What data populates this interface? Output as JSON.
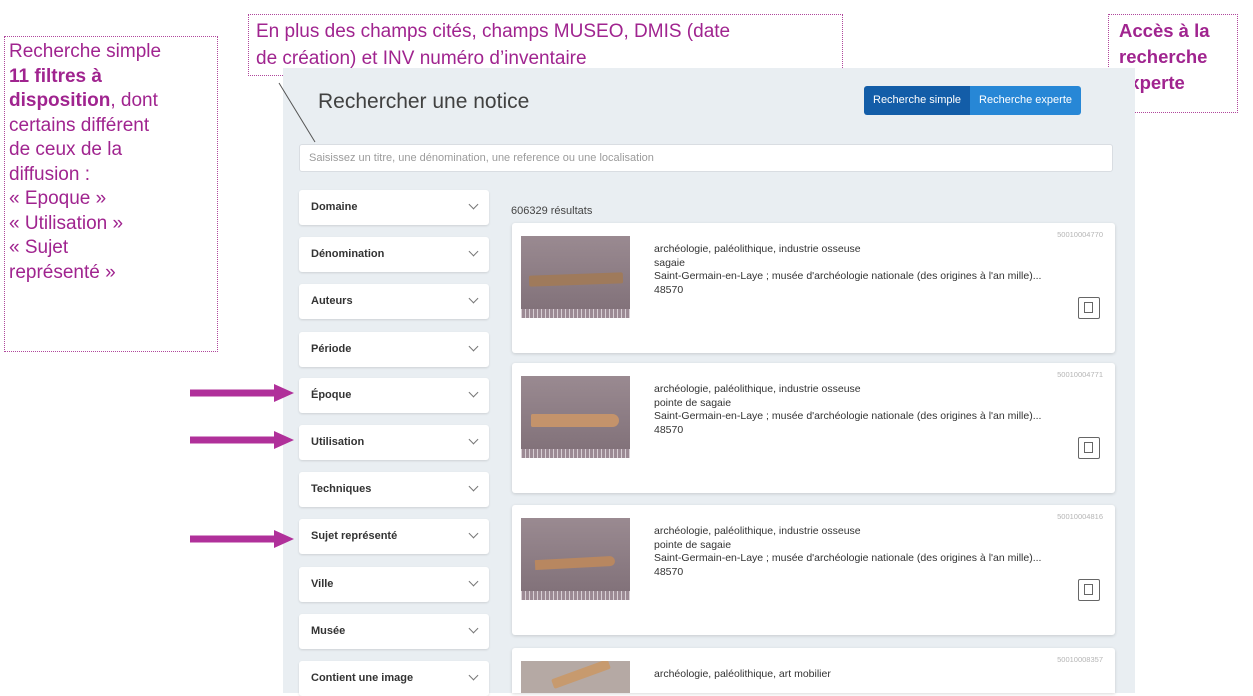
{
  "annotations": {
    "top": "En plus des champs cités, champs MUSEO, DMIS (date de création) et INV numéro d’inventaire",
    "top_line1": "En plus des champs cités, champs MUSEO,  DMIS (date",
    "top_line2": "de création) et INV numéro d’inventaire",
    "left_intro": "Recherche simple",
    "left_bold": "11 filtres à disposition",
    "left_bold_line1": "11 filtres à",
    "left_bold_line2": "disposition",
    "left_rest": ", dont certains différent de ceux de la diffusion :",
    "left_rest_line1": ", dont",
    "left_rest_line2": "certains différent",
    "left_rest_line3": "de ceux de la",
    "left_rest_line4": "diffusion :",
    "left_item1": "« Epoque »",
    "left_item2": "« Utilisation »",
    "left_item3_line1": "« Sujet",
    "left_item3_line2": "représenté »",
    "right_line1": "Accès à la",
    "right_line2": "recherche",
    "right_line3": "experte"
  },
  "colors": {
    "annotation": "#a0248f",
    "arrow": "#b0309a",
    "primary_button": "#135da8",
    "secondary_button": "#2787d6",
    "panel_bg": "#e9eef2"
  },
  "header": {
    "title": "Rechercher une notice",
    "simple_label": "Recherche simple",
    "expert_label": "Recherche experte"
  },
  "search": {
    "placeholder": "Saisissez un titre, une dénomination, une reference ou une localisation"
  },
  "filters": [
    {
      "label": "Domaine"
    },
    {
      "label": "Dénomination"
    },
    {
      "label": "Auteurs"
    },
    {
      "label": "Période"
    },
    {
      "label": "Époque"
    },
    {
      "label": "Utilisation"
    },
    {
      "label": "Techniques"
    },
    {
      "label": "Sujet représenté"
    },
    {
      "label": "Ville"
    },
    {
      "label": "Musée"
    },
    {
      "label": "Contient une image"
    }
  ],
  "results": {
    "count": "606329 résultats",
    "items": [
      {
        "ref": "50010004770",
        "domain": "archéologie, paléolithique, industrie osseuse",
        "name": "sagaie",
        "location": "Saint-Germain-en-Laye ; musée d'archéologie nationale (des origines à l'an mille)...",
        "inventory": "48570"
      },
      {
        "ref": "50010004771",
        "domain": "archéologie, paléolithique, industrie osseuse",
        "name": "pointe de sagaie",
        "location": "Saint-Germain-en-Laye ; musée d'archéologie nationale (des origines à l'an mille)...",
        "inventory": "48570"
      },
      {
        "ref": "50010004816",
        "domain": "archéologie, paléolithique, industrie osseuse",
        "name": "pointe de sagaie",
        "location": "Saint-Germain-en-Laye ; musée d'archéologie nationale (des origines à l'an mille)...",
        "inventory": "48570"
      },
      {
        "ref": "50010008357",
        "domain": "archéologie, paléolithique, art mobilier",
        "name": "",
        "location": "",
        "inventory": ""
      }
    ]
  },
  "icons": {
    "qr": "qr-code-icon",
    "chevron": "chevron-down-icon",
    "arrow": "arrow-right-icon"
  }
}
